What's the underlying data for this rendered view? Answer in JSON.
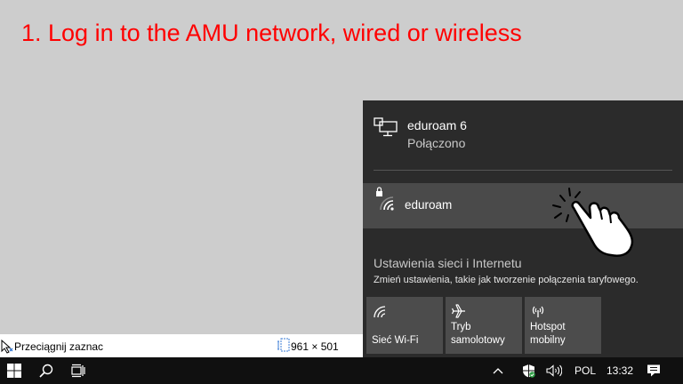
{
  "instruction": "1. Log in to the AMU network, wired or wireless",
  "connection": {
    "name": "eduroam 6",
    "status": "Połączono",
    "icon": "ethernet-icon"
  },
  "network": {
    "name": "eduroam",
    "icon": "wifi-secured-icon"
  },
  "settings": {
    "link": "Ustawienia sieci i Internetu",
    "description": "Zmień ustawienia, takie jak tworzenie połączenia taryfowego."
  },
  "quick_actions": [
    {
      "line1": "Sieć Wi-Fi",
      "line2": "",
      "icon": "wifi-icon"
    },
    {
      "line1": "Tryb",
      "line2": "samolotowy",
      "icon": "airplane-icon"
    },
    {
      "line1": "Hotspot",
      "line2": "mobilny",
      "icon": "hotspot-icon"
    }
  ],
  "status_bar": {
    "selection_hint": "Przeciągnij zaznac",
    "dimensions": "961 × 501"
  },
  "taskbar": {
    "language": "POL",
    "time": "13:32"
  },
  "colors": {
    "instruction": "#ff0000",
    "flyout_bg": "#2b2b2b",
    "selected_row": "#4a4a4a",
    "tile": "#4c4c4c",
    "taskbar": "#101010",
    "defender": "#2e9e44"
  }
}
